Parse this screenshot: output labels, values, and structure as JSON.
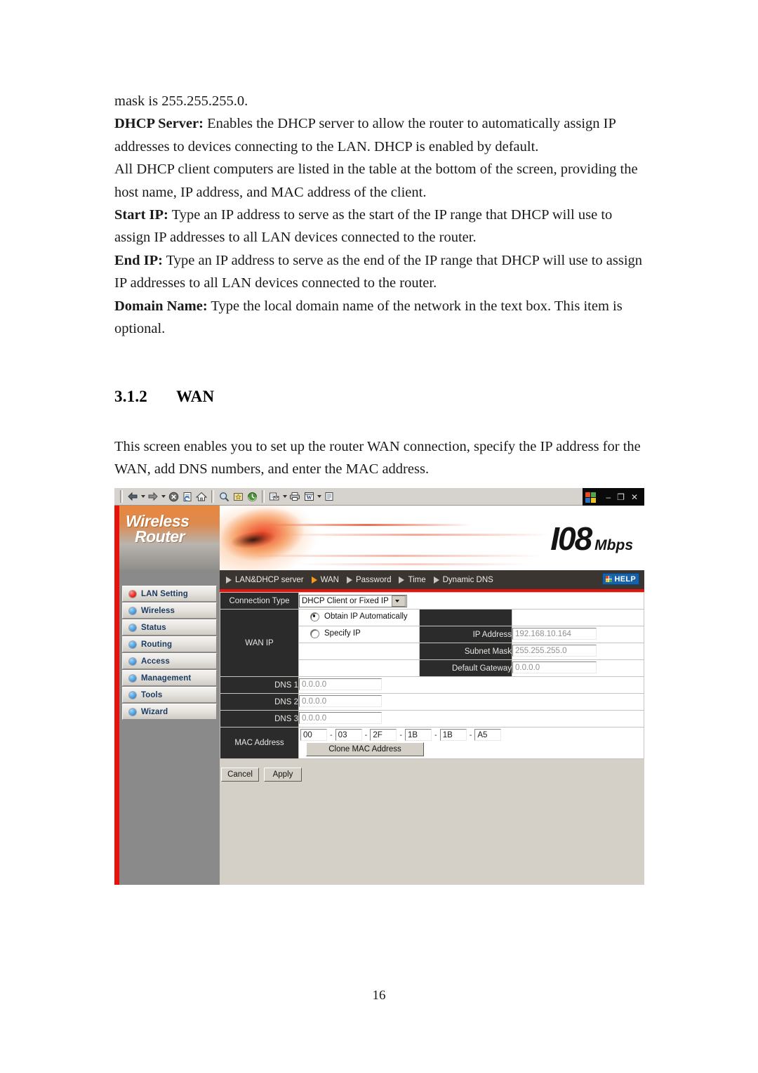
{
  "document": {
    "paragraphs": [
      {
        "text": "mask is 255.255.255.0."
      },
      {
        "bold": "DHCP Server:",
        "text": " Enables the DHCP server to allow the router to automatically assign IP addresses to devices connecting to the LAN. DHCP is enabled by default."
      },
      {
        "text": "All DHCP client computers are listed in the table at the bottom of the screen, providing the host name, IP address, and MAC address of the client."
      },
      {
        "bold": "Start IP:",
        "text": " Type an IP address to serve as the start of the IP range that DHCP will use to assign IP addresses to all LAN devices connected to the router."
      },
      {
        "bold": "End IP:",
        "text": " Type an IP address to serve as the end of the IP range that DHCP will use to assign IP addresses to all LAN devices connected to the router."
      },
      {
        "bold": "Domain Name:",
        "text": " Type the local domain name of the network in the text box. This item is optional."
      }
    ],
    "section": {
      "number": "3.1.2",
      "title": "WAN"
    },
    "intro": "This screen enables you to set up the router WAN connection, specify the IP address for the WAN, add DNS numbers, and enter the MAC address.",
    "page_number": "16"
  },
  "browser": {
    "toolbar_icons": [
      "back-icon",
      "back-dropdown-icon",
      "forward-icon",
      "forward-dropdown-icon",
      "stop-icon",
      "refresh-icon",
      "home-icon",
      "search-icon",
      "favorites-icon",
      "history-icon",
      "mail-icon",
      "mail-dropdown-icon",
      "print-icon",
      "edit-word-icon",
      "edit-dropdown-icon",
      "discuss-icon"
    ],
    "window_controls": {
      "app_icon": "windows-logo-icon",
      "minimize": "–",
      "restore": "❐",
      "close": "✕"
    }
  },
  "router": {
    "brand": {
      "line1": "Wireless",
      "line2": "Router",
      "speed": "I08",
      "speed_unit": "Mbps"
    },
    "nav": {
      "items": [
        {
          "label": "LAN&DHCP server",
          "active": false
        },
        {
          "label": "WAN",
          "active": true
        },
        {
          "label": "Password",
          "active": false
        },
        {
          "label": "Time",
          "active": false
        },
        {
          "label": "Dynamic DNS",
          "active": false
        }
      ],
      "help_label": "HELP"
    },
    "sidebar": {
      "items": [
        {
          "label": "LAN Setting",
          "active": true
        },
        {
          "label": "Wireless",
          "active": false
        },
        {
          "label": "Status",
          "active": false
        },
        {
          "label": "Routing",
          "active": false
        },
        {
          "label": "Access",
          "active": false
        },
        {
          "label": "Management",
          "active": false
        },
        {
          "label": "Tools",
          "active": false
        },
        {
          "label": "Wizard",
          "active": false
        }
      ]
    },
    "form": {
      "connection_type_label": "Connection Type",
      "connection_type_value": "DHCP Client or Fixed IP",
      "wan_ip_label": "WAN IP",
      "obtain_auto_label": "Obtain IP Automatically",
      "specify_ip_label": "Specify IP",
      "ip_address_label": "IP Address",
      "ip_address_value": "192.168.10.164",
      "subnet_mask_label": "Subnet Mask",
      "subnet_mask_value": "255.255.255.0",
      "default_gateway_label": "Default Gateway",
      "default_gateway_value": "0.0.0.0",
      "dns1_label": "DNS 1",
      "dns1_value": "0.0.0.0",
      "dns2_label": "DNS 2",
      "dns2_value": "0.0.0.0",
      "dns3_label": "DNS 3",
      "dns3_value": "0.0.0.0",
      "mac_label": "MAC Address",
      "mac_octets": [
        "00",
        "03",
        "2F",
        "1B",
        "1B",
        "A5"
      ],
      "mac_separator": "-",
      "clone_mac_label": "Clone MAC Address",
      "cancel_label": "Cancel",
      "apply_label": "Apply"
    },
    "colors": {
      "accent_red": "#e8120c",
      "nav_bar": "#3a3531",
      "label_dark": "#2b2b2b",
      "help_blue": "#1661a8",
      "sidebar_gray": "#8a8a8a",
      "content_gray": "#d4d0c8"
    }
  }
}
